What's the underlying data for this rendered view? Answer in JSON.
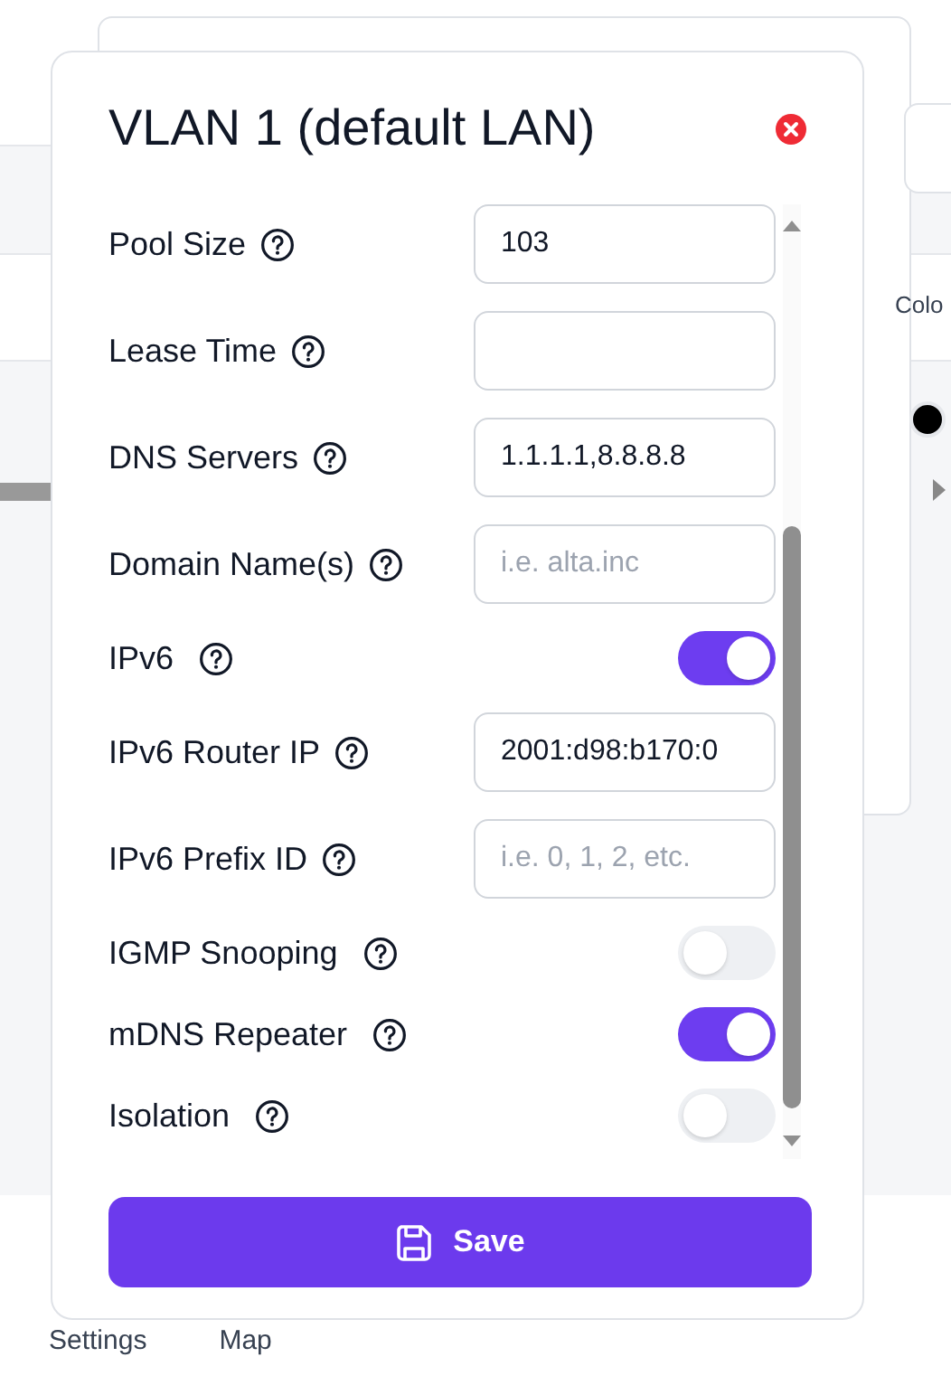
{
  "background": {
    "column_label": "Colo",
    "bottom_tabs": [
      "Settings",
      "Map"
    ]
  },
  "dialog": {
    "title": "VLAN 1 (default LAN)",
    "fields": [
      {
        "kind": "input",
        "label": "Pool Size",
        "value": "103"
      },
      {
        "kind": "input",
        "label": "Lease Time"
      },
      {
        "kind": "input",
        "label": "DNS Servers",
        "value": "1.1.1.1,8.8.8.8"
      },
      {
        "kind": "input",
        "label": "Domain Name(s)",
        "placeholder": "i.e. alta.inc"
      },
      {
        "kind": "toggle",
        "label": "IPv6",
        "on": true
      },
      {
        "kind": "input",
        "label": "IPv6 Router IP",
        "value": "2001:d98:b170:0"
      },
      {
        "kind": "input",
        "label": "IPv6 Prefix ID",
        "placeholder": "i.e. 0, 1, 2, etc."
      },
      {
        "kind": "toggle",
        "label": "IGMP Snooping",
        "on": false
      },
      {
        "kind": "toggle",
        "label": "mDNS Repeater",
        "on": true
      },
      {
        "kind": "toggle",
        "label": "Isolation",
        "on": false
      }
    ],
    "save_button": "Save"
  }
}
